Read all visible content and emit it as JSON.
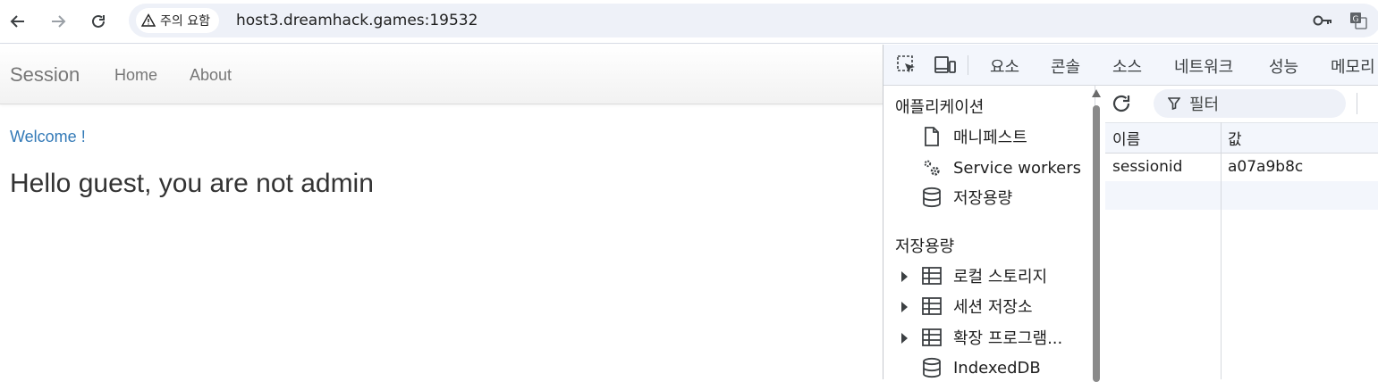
{
  "browser": {
    "security_chip": "주의 요함",
    "url": "host3.dreamhack.games:19532"
  },
  "site": {
    "brand": "Session",
    "nav": [
      {
        "label": "Home"
      },
      {
        "label": "About"
      }
    ],
    "welcome": "Welcome !",
    "heading": "Hello guest, you are not admin"
  },
  "devtools": {
    "tabs": [
      {
        "label": "요소"
      },
      {
        "label": "콘솔"
      },
      {
        "label": "소스"
      },
      {
        "label": "네트워크"
      },
      {
        "label": "성능"
      },
      {
        "label": "메모리"
      }
    ],
    "sidebar": {
      "application_header": "애플리케이션",
      "application_items": [
        {
          "label": "매니페스트",
          "icon": "document-icon"
        },
        {
          "label": "Service workers",
          "icon": "gears-icon"
        },
        {
          "label": "저장용량",
          "icon": "database-icon"
        }
      ],
      "storage_header": "저장용량",
      "storage_items": [
        {
          "label": "로컬 스토리지",
          "icon": "table-icon"
        },
        {
          "label": "세션 저장소",
          "icon": "table-icon"
        },
        {
          "label": "확장 프로그램...",
          "icon": "table-icon"
        },
        {
          "label": "IndexedDB",
          "icon": "database-icon"
        }
      ]
    },
    "filter_placeholder": "필터",
    "table": {
      "columns": [
        "이름",
        "값"
      ],
      "rows": [
        {
          "name": "sessionid",
          "value": "a07a9b8c"
        }
      ]
    }
  }
}
